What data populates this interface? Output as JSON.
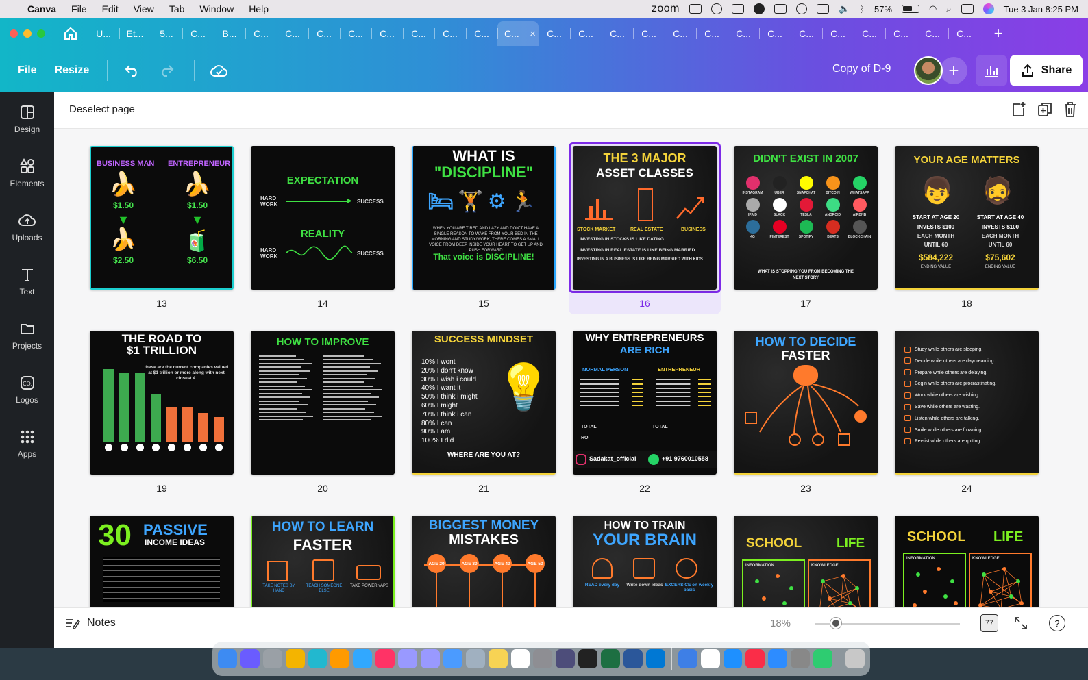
{
  "menubar": {
    "app": "Canva",
    "items": [
      "File",
      "Edit",
      "View",
      "Tab",
      "Window",
      "Help"
    ],
    "zoom_label": "zoom",
    "battery": "57%",
    "datetime": "Tue 3 Jan  8:25 PM"
  },
  "tabs": {
    "labels": [
      "U...",
      "Et...",
      "5...",
      "C...",
      "B...",
      "C...",
      "C...",
      "C...",
      "C...",
      "C...",
      "C...",
      "C...",
      "C...",
      "C...",
      "C...",
      "C...",
      "C...",
      "C...",
      "C...",
      "C...",
      "C...",
      "C...",
      "C...",
      "C...",
      "C...",
      "C...",
      "C...",
      "C..."
    ],
    "active_index": 13,
    "close": "×",
    "new_tab": "+"
  },
  "toolbar": {
    "file": "File",
    "resize": "Resize",
    "doc_title": "Copy of D-9",
    "add": "+",
    "share": "Share"
  },
  "rail": [
    {
      "label": "Design",
      "icon": "design-icon"
    },
    {
      "label": "Elements",
      "icon": "elements-icon"
    },
    {
      "label": "Uploads",
      "icon": "uploads-icon"
    },
    {
      "label": "Text",
      "icon": "text-icon"
    },
    {
      "label": "Projects",
      "icon": "projects-icon"
    },
    {
      "label": "Logos",
      "icon": "logos-icon"
    },
    {
      "label": "Apps",
      "icon": "apps-icon"
    }
  ],
  "subbar": {
    "deselect": "Deselect page"
  },
  "pages": {
    "p13": {
      "num": "13",
      "left": "BUSINESS MAN",
      "right": "ENTREPRENEUR",
      "p1": "$1.50",
      "p2": "$1.50",
      "p3": "$2.50",
      "p4": "$6.50"
    },
    "p14": {
      "num": "14",
      "t1": "EXPECTATION",
      "t2": "REALITY",
      "hw": "HARD WORK",
      "s": "SUCCESS"
    },
    "p15": {
      "num": "15",
      "t1": "WHAT IS",
      "t2": "\"DISCIPLINE\"",
      "body": "WHEN YOU ARE TIRED AND LAZY AND DON`T HAVE A SINGLE REASON TO WAKE FROM YOUR BED IN THE MORNING AND STUDY/WORK, THERE COMES A SMALL VOICE FROM DEEP INSIDE YOUR HEART TO GET UP AND PUSH FORWARD",
      "foot": "That voice is DISCIPLINE!"
    },
    "p16": {
      "num": "16",
      "t1": "THE 3 MAJOR",
      "t2": "ASSET CLASSES",
      "c1": "STOCK MARKET",
      "c2": "REAL ESTATE",
      "c3": "BUSINESS",
      "l1": "INVESTING IN STOCKS IS LIKE DATING.",
      "l2": "INVESTING IN REAL ESTATE IS LIKE BEING MARRIED.",
      "l3": "INVESTING IN A BUSINESS IS LIKE BEING MARRIED WITH KIDS."
    },
    "p17": {
      "num": "17",
      "t1": "DIDN'T EXIST IN 2007",
      "apps": [
        "INSTAGRAM",
        "UBER",
        "SNAPCHAT",
        "BITCOIN",
        "WHATSAPP",
        "IPAID",
        "SLACK",
        "TESLA",
        "ANDROID",
        "AIRBNB",
        "4G",
        "PINTEREST",
        "SPOTIFY",
        "BEATS",
        "BLOCKCHAIN"
      ],
      "foot": "WHAT IS STOPPING YOU FROM BECOMING THE NEXT STORY"
    },
    "p18": {
      "num": "18",
      "t1": "YOUR AGE MATTERS",
      "a1": "START AT AGE 20",
      "a2": "START AT AGE 40",
      "i1": "INVESTS $100",
      "i2": "INVESTS $100",
      "m": "EACH MONTH",
      "u": "UNTIL 60",
      "v1": "$584,222",
      "v2": "$75,602",
      "ev": "ENDING VALUE"
    },
    "p19": {
      "num": "19",
      "t1": "THE ROAD TO",
      "t2": "$1 TRILLION",
      "sub": "these are the current companies valued at $1 trillion or more along with next closest 4."
    },
    "p20": {
      "num": "20",
      "t1": "HOW TO IMPROVE"
    },
    "p21": {
      "num": "21",
      "t1": "SUCCESS MINDSET",
      "rows": [
        "10% I wont",
        "20% I don't know",
        "30% I wish i could",
        "40% I want it",
        "50% I think i might",
        "60% I might",
        "70% I think i can",
        "80% I can",
        "90% I am",
        "100% I did"
      ],
      "foot": "WHERE ARE YOU AT?"
    },
    "p22": {
      "num": "22",
      "t1": "WHY ENTREPRENEURS",
      "t2": "ARE RICH",
      "h1": "NORMAL PERSON",
      "h2": "ENTREPRENEUR",
      "total": "TOTAL",
      "roi": "ROI",
      "handle": "Sadakat_official",
      "phone": "+91 9760010558"
    },
    "p23": {
      "num": "23",
      "t1": "HOW TO DECIDE",
      "t2": "FASTER"
    },
    "p24": {
      "num": "24",
      "rows": [
        "Study while others are sleeping.",
        "Decide while others are daydreaming.",
        "Prepare while others are delaying.",
        "Begin while others are procrastinating.",
        "Work while others are wishing.",
        "Save while others are wasting.",
        "Listen while others are talking.",
        "Smile while others are frowning.",
        "Persist while others are quiting."
      ]
    },
    "p25": {
      "t1": "30",
      "t2": "PASSIVE",
      "t3": "INCOME IDEAS"
    },
    "p26": {
      "t1": "HOW TO LEARN",
      "t2": "FASTER",
      "a": "TAKE NOTES BY HAND",
      "b": "TEACH SOMEONE ELSE",
      "c": "TAKE POWERNAPS"
    },
    "p27": {
      "t1": "BIGGEST MONEY",
      "t2": "MISTAKES",
      "ages": [
        "AGE 20",
        "AGE 30",
        "AGE 40",
        "AGE 50"
      ]
    },
    "p28": {
      "t1": "HOW TO TRAIN",
      "t2": "YOUR BRAIN",
      "a": "READ every day",
      "b": "Write down ideas",
      "c": "EXCERSICE on weekly basis"
    },
    "p29": {
      "t1": "SCHOOL",
      "t2": "LIFE",
      "a": "INFORMATION",
      "b": "KNOWLEDGE"
    },
    "p30": {
      "t1": "SCHOOL",
      "t2": "LIFE",
      "a": "INFORMATION",
      "b": "KNOWLEDGE"
    }
  },
  "bottombar": {
    "notes": "Notes",
    "zoom": "18%",
    "pages": "77",
    "help": "?"
  },
  "dock": [
    "Finder",
    "Siri",
    "Launchpad",
    "Chrome",
    "Canva",
    "Illustrator",
    "Photoshop",
    "InDesign",
    "Premiere",
    "After Effects",
    "Mail",
    "Preview",
    "Notes",
    "Reminders",
    "Settings",
    "Screen",
    "Terminal",
    "Excel",
    "Word",
    "Outlook",
    "Files",
    "Calendar",
    "Safari",
    "Music",
    "Zoom",
    "Activity",
    "Migration",
    "Trash"
  ],
  "colors": {
    "accent": "#7d2ae8",
    "gradient_start": "#12b6c8",
    "gradient_end": "#8a3ee6"
  }
}
